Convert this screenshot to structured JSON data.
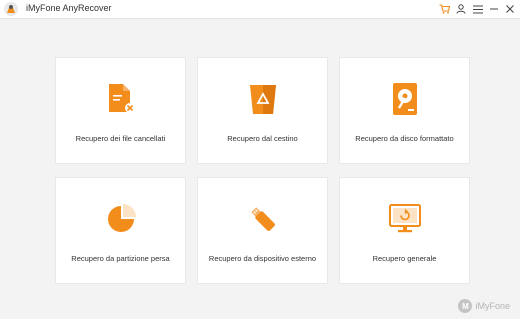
{
  "window": {
    "title": "iMyFone AnyRecover"
  },
  "toolbar": {
    "icons": [
      "cart-icon",
      "user-icon",
      "menu-icon",
      "minimize-icon",
      "close-icon"
    ],
    "accent": "#f28c1b"
  },
  "options": [
    {
      "label": "Recupero dei file cancellati",
      "icon": "deleted-file-icon"
    },
    {
      "label": "Recupero dal cestino",
      "icon": "recycle-bin-icon"
    },
    {
      "label": "Recupero da disco formattato",
      "icon": "formatted-disk-icon"
    },
    {
      "label": "Recupero da partizione persa",
      "icon": "lost-partition-icon"
    },
    {
      "label": "Recupero da dispositivo esterno",
      "icon": "usb-drive-icon"
    },
    {
      "label": "Recupero generale",
      "icon": "general-recovery-icon"
    }
  ],
  "branding": {
    "text": "iMyFone",
    "mark": "M"
  }
}
